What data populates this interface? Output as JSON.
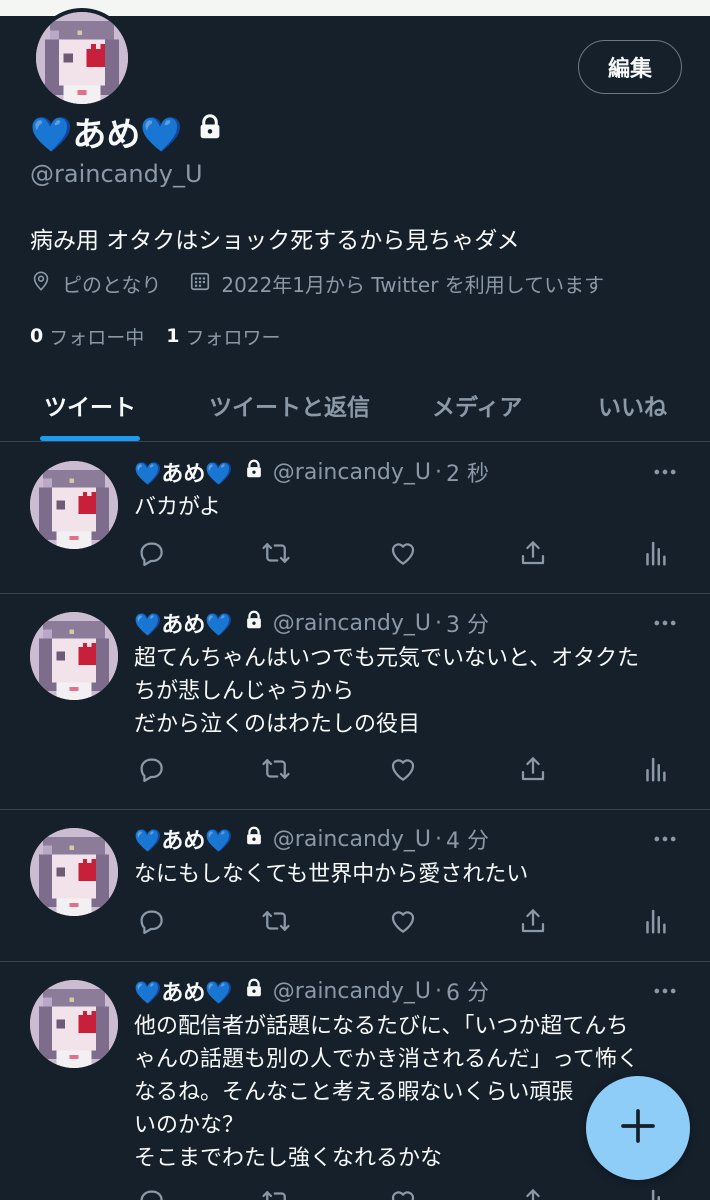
{
  "profile": {
    "edit_label": "編集",
    "display_name": "💙あめ💙",
    "handle": "@raincandy_U",
    "bio": "病み用 オタクはショック死するから見ちゃダメ",
    "location": "ピのとなり",
    "joined": "2022年1月から Twitter を利用しています",
    "following_count": "0",
    "following_label": "フォロー中",
    "followers_count": "1",
    "followers_label": "フォロワー",
    "icons": {
      "protected": "lock-icon",
      "location": "location-pin-icon",
      "joined": "calendar-icon"
    }
  },
  "tabs": [
    {
      "label": "ツイート",
      "active": true
    },
    {
      "label": "ツイートと返信",
      "active": false
    },
    {
      "label": "メディア",
      "active": false
    },
    {
      "label": "いいね",
      "active": false
    }
  ],
  "tweets": [
    {
      "name": "💙あめ💙",
      "username": "@raincandy_U",
      "sep": "·",
      "time": "2 秒",
      "text": "バカがよ"
    },
    {
      "name": "💙あめ💙",
      "username": "@raincandy_U",
      "sep": "·",
      "time": "3 分",
      "text": "超てんちゃんはいつでも元気でいないと、オタクた\nちが悲しんじゃうから\nだから泣くのはわたしの役目"
    },
    {
      "name": "💙あめ💙",
      "username": "@raincandy_U",
      "sep": "·",
      "time": "4 分",
      "text": "なにもしなくても世界中から愛されたい"
    },
    {
      "name": "💙あめ💙",
      "username": "@raincandy_U",
      "sep": "·",
      "time": "6 分",
      "text": "他の配信者が話題になるたびに、「いつか超てんち\nゃんの話題も別の人でかき消されるんだ」って怖く\nなるね。そんなこと考える暇ないくらい頑張\nいのかな？\nそこまでわたし強くなれるかな"
    }
  ],
  "action_icons": [
    "reply-icon",
    "retweet-icon",
    "like-icon",
    "share-icon",
    "analytics-icon"
  ],
  "fab": {
    "icon": "compose-plus-icon"
  },
  "colors": {
    "background": "#15202b",
    "text": "#f7f9f9",
    "secondary_text": "#8b98a5",
    "accent": "#1d9bf0",
    "divider": "#38444d",
    "fab": "#8ecdf7"
  }
}
